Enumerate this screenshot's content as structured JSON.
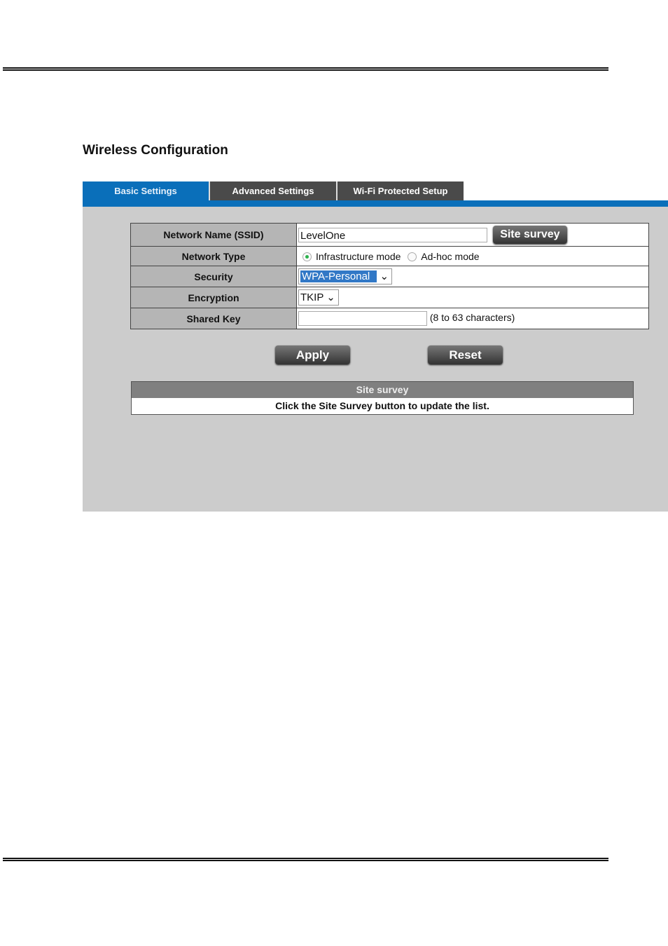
{
  "page_title": "Wireless Configuration",
  "tabs": [
    {
      "label": "Basic Settings",
      "active": true
    },
    {
      "label": "Advanced Settings"
    },
    {
      "label": "Wi-Fi Protected Setup"
    }
  ],
  "form": {
    "ssid_label": "Network Name (SSID)",
    "ssid_value": "LevelOne",
    "site_survey_button": "Site survey",
    "network_type_label": "Network Type",
    "infrastructure": "Infrastructure mode",
    "adhoc": "Ad-hoc mode",
    "selected_mode": "Infrastructure mode",
    "security_label": "Security",
    "security_value": "WPA-Personal",
    "encryption_label": "Encryption",
    "encryption_value": "TKIP",
    "shared_key_label": "Shared Key",
    "shared_key_value": "",
    "shared_key_hint": "(8 to 63 characters)"
  },
  "buttons": {
    "apply": "Apply",
    "reset": "Reset"
  },
  "survey": {
    "header": "Site survey",
    "message": "Click the Site Survey button to update the list."
  },
  "colors": {
    "accent": "#0a6fba",
    "panel": "#cccccc"
  }
}
